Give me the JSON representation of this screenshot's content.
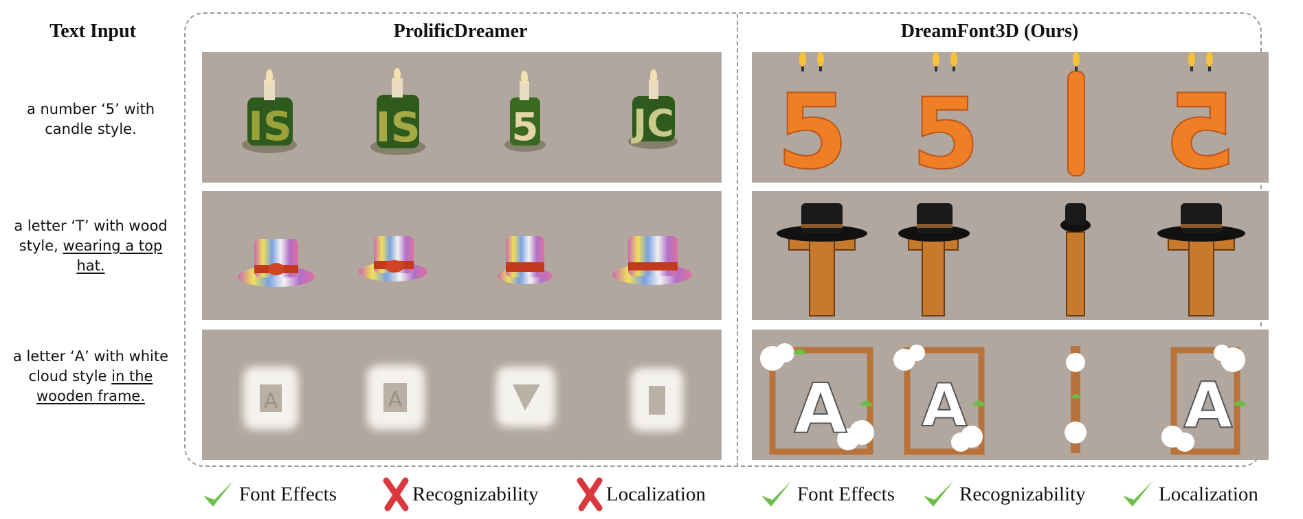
{
  "header": {
    "text_input_label": "Text Input",
    "left_method": "ProlificDreamer",
    "right_method": "DreamFont3D (Ours)"
  },
  "prompts": [
    {
      "line1": "a number ‘5’ with",
      "line2": "candle style.",
      "line3": "",
      "line4": ""
    },
    {
      "line1": "a letter ‘T’ with wood",
      "line2": "style,",
      "line2_u": "wearing a top",
      "line3": "hat.",
      "line4": ""
    },
    {
      "line1": "a letter ‘A’ with white",
      "line2": "cloud style",
      "line2_u": "in the",
      "line3": "wooden frame.",
      "line4": ""
    }
  ],
  "legend": {
    "left": [
      {
        "status": "check",
        "label": "Font Effects"
      },
      {
        "status": "cross",
        "label": "Recognizability"
      },
      {
        "status": "cross",
        "label": "Localization"
      }
    ],
    "right": [
      {
        "status": "check",
        "label": "Font Effects"
      },
      {
        "status": "check",
        "label": "Recognizability"
      },
      {
        "status": "check",
        "label": "Localization"
      }
    ]
  },
  "colors": {
    "panel_bg": "#b1a79e",
    "check": "#6cbf4b",
    "cross": "#d9383e",
    "candle_orange": "#f07e25",
    "wood": "#c77a2c",
    "frame_border": "#9a9a9a"
  },
  "icons": [
    "check-icon",
    "cross-icon"
  ]
}
